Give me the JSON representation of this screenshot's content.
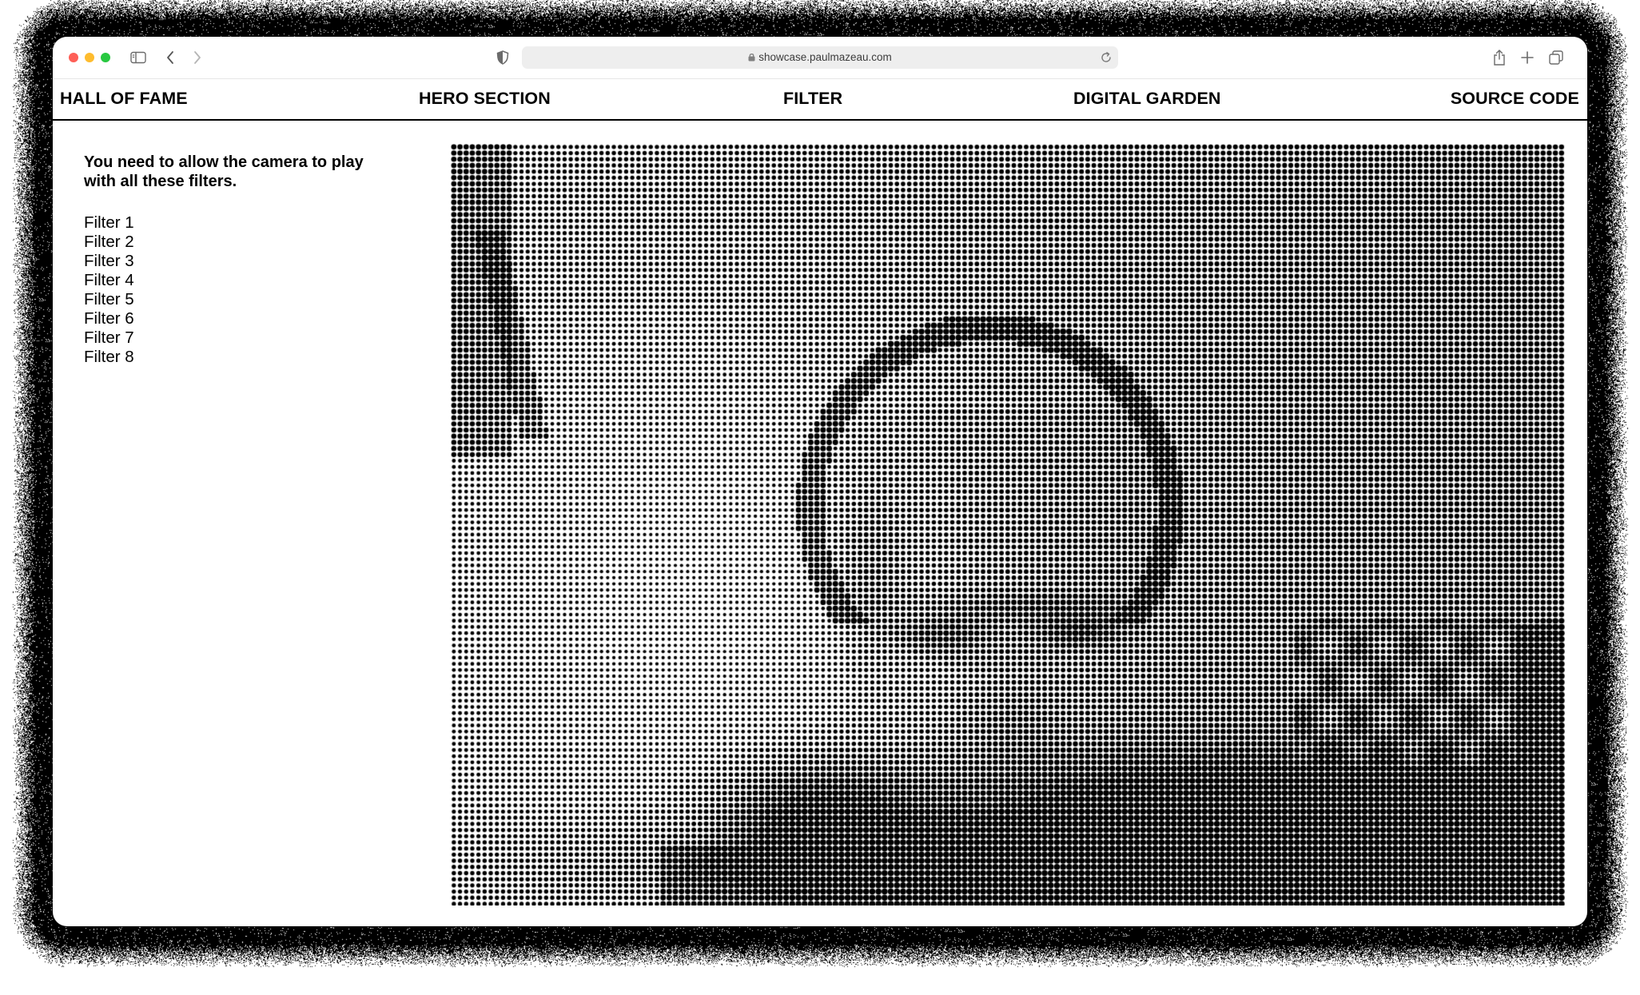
{
  "browser": {
    "url": "showcase.paulmazeau.com"
  },
  "nav": {
    "items": [
      {
        "label": "HALL OF FAME"
      },
      {
        "label": "HERO SECTION"
      },
      {
        "label": "FILTER"
      },
      {
        "label": "DIGITAL GARDEN"
      },
      {
        "label": "SOURCE CODE"
      }
    ]
  },
  "sidebar": {
    "notice": "You need to allow the camera to play with all these filters.",
    "filters": [
      "Filter 1",
      "Filter 2",
      "Filter 3",
      "Filter 4",
      "Filter 5",
      "Filter 6",
      "Filter 7",
      "Filter 8"
    ]
  },
  "icons": {
    "sidebar_toggle": "sidebar-toggle-icon",
    "back": "chevron-left-icon",
    "forward": "chevron-right-icon",
    "privacy": "shield-icon",
    "lock": "lock-icon",
    "reload": "reload-icon",
    "share": "share-icon",
    "new_tab": "plus-icon",
    "tabs": "tab-overview-icon"
  },
  "colors": {
    "text": "#000000",
    "background": "#ffffff",
    "close": "#fe5f57",
    "minimize": "#febc2e",
    "maximize": "#28c840"
  }
}
